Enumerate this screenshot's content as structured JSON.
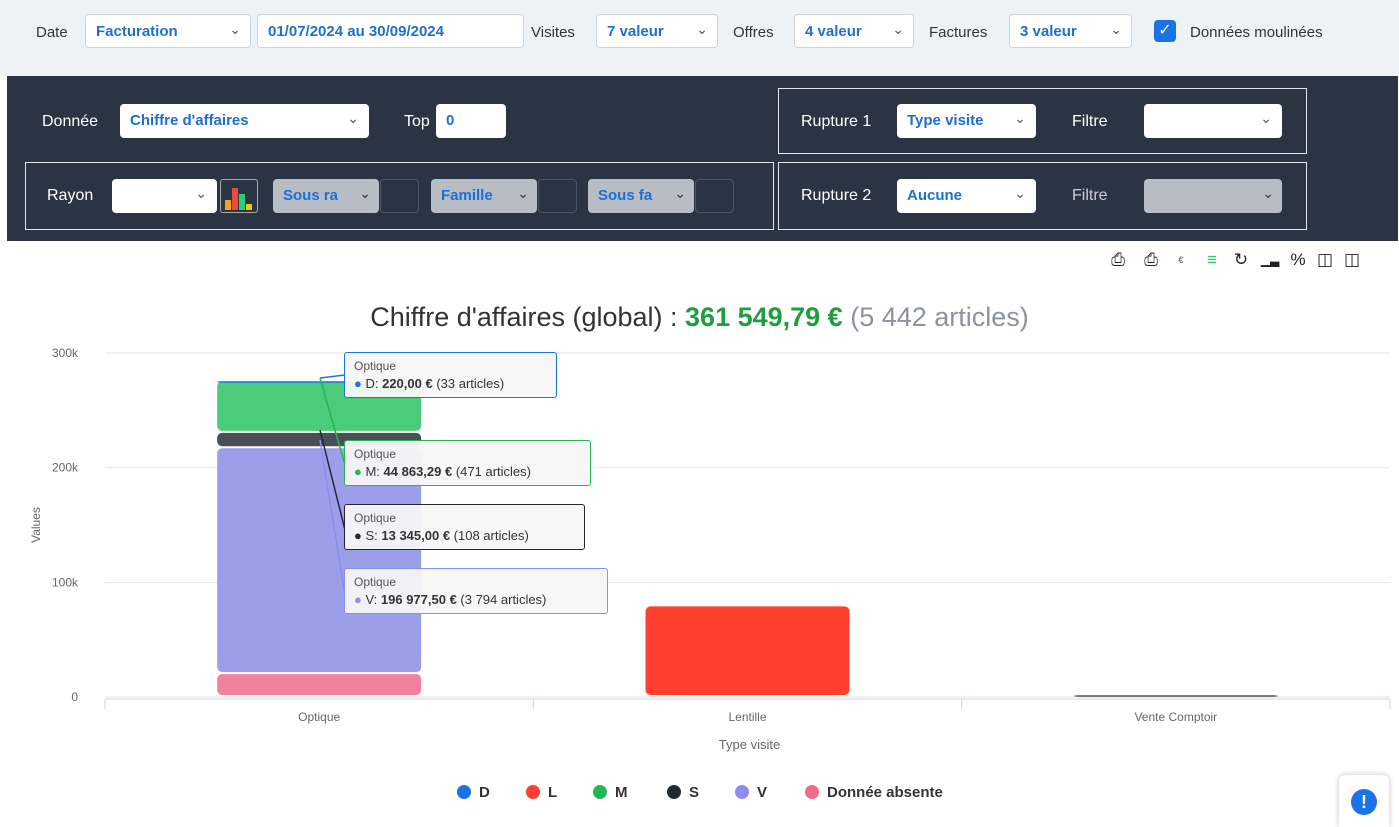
{
  "filters": {
    "date_label": "Date",
    "date_mode": "Facturation",
    "date_range": "01/07/2024 au 30/09/2024",
    "visites_label": "Visites",
    "visites_value": "7 valeur",
    "offres_label": "Offres",
    "offres_value": "4 valeur",
    "factures_label": "Factures",
    "factures_value": "3 valeur",
    "checkbox_label": "Données moulinées"
  },
  "panel": {
    "donnee_label": "Donnée",
    "donnee_value": "Chiffre d'affaires",
    "top_label": "Top",
    "top_value": "0",
    "rayon_label": "Rayon",
    "rayon_value": "",
    "sous_rayon": "Sous ra",
    "famille": "Famille",
    "sous_famille": "Sous fa",
    "rupture1_label": "Rupture 1",
    "rupture1_value": "Type visite",
    "filtre1_label": "Filtre",
    "rupture2_label": "Rupture 2",
    "rupture2_value": "Aucune",
    "filtre2_label": "Filtre"
  },
  "toolbar_icons": [
    "export-icon",
    "print-icon",
    "currency-icon",
    "stack-icon",
    "refresh-icon",
    "bar-icon",
    "percent-icon",
    "columns-icon",
    "save-icon"
  ],
  "chart_title": {
    "prefix": "Chiffre d'affaires (global) :",
    "amount": "361 549,79 €",
    "count": "(5 442 articles)"
  },
  "chart_data": {
    "type": "bar",
    "stacked": true,
    "categories": [
      "Optique",
      "Lentille",
      "Vente Comptoir"
    ],
    "xlabel": "Type visite",
    "ylabel": "Values",
    "ylim": [
      0,
      300000
    ],
    "yticks": [
      "0",
      "100k",
      "200k",
      "300k"
    ],
    "series": [
      {
        "name": "Donnée absente",
        "color": "#f0829c",
        "values": [
          20000,
          0,
          0
        ]
      },
      {
        "name": "V",
        "color": "#9c9eea",
        "values": [
          196977.5,
          0,
          0
        ]
      },
      {
        "name": "S",
        "color": "#4a4f57",
        "values": [
          13345,
          0,
          1500
        ]
      },
      {
        "name": "M",
        "color": "#4ccb7a",
        "values": [
          44863.29,
          0,
          0
        ]
      },
      {
        "name": "D",
        "color": "#1a73e8",
        "values": [
          220,
          0,
          0
        ]
      },
      {
        "name": "L",
        "color": "#ff4030",
        "values": [
          0,
          79000,
          0
        ]
      }
    ],
    "legend": [
      {
        "name": "D",
        "color": "#1a73e8"
      },
      {
        "name": "L",
        "color": "#ff4030"
      },
      {
        "name": "M",
        "color": "#22b755"
      },
      {
        "name": "S",
        "color": "#212a33"
      },
      {
        "name": "V",
        "color": "#8b8df0"
      },
      {
        "name": "Donnée absente",
        "color": "#f06a8a"
      }
    ]
  },
  "tooltips": [
    {
      "category": "Optique",
      "series": "D",
      "color": "#1a73e8",
      "value": "220,00 €",
      "articles": "(33 articles)"
    },
    {
      "category": "Optique",
      "series": "M",
      "color": "#22b755",
      "value": "44 863,29 €",
      "articles": "(471 articles)"
    },
    {
      "category": "Optique",
      "series": "S",
      "color": "#212a33",
      "value": "13 345,00 €",
      "articles": "(108 articles)"
    },
    {
      "category": "Optique",
      "series": "V",
      "color": "#8b8df0",
      "value": "196 977,50 €",
      "articles": "(3 794 articles)"
    }
  ]
}
